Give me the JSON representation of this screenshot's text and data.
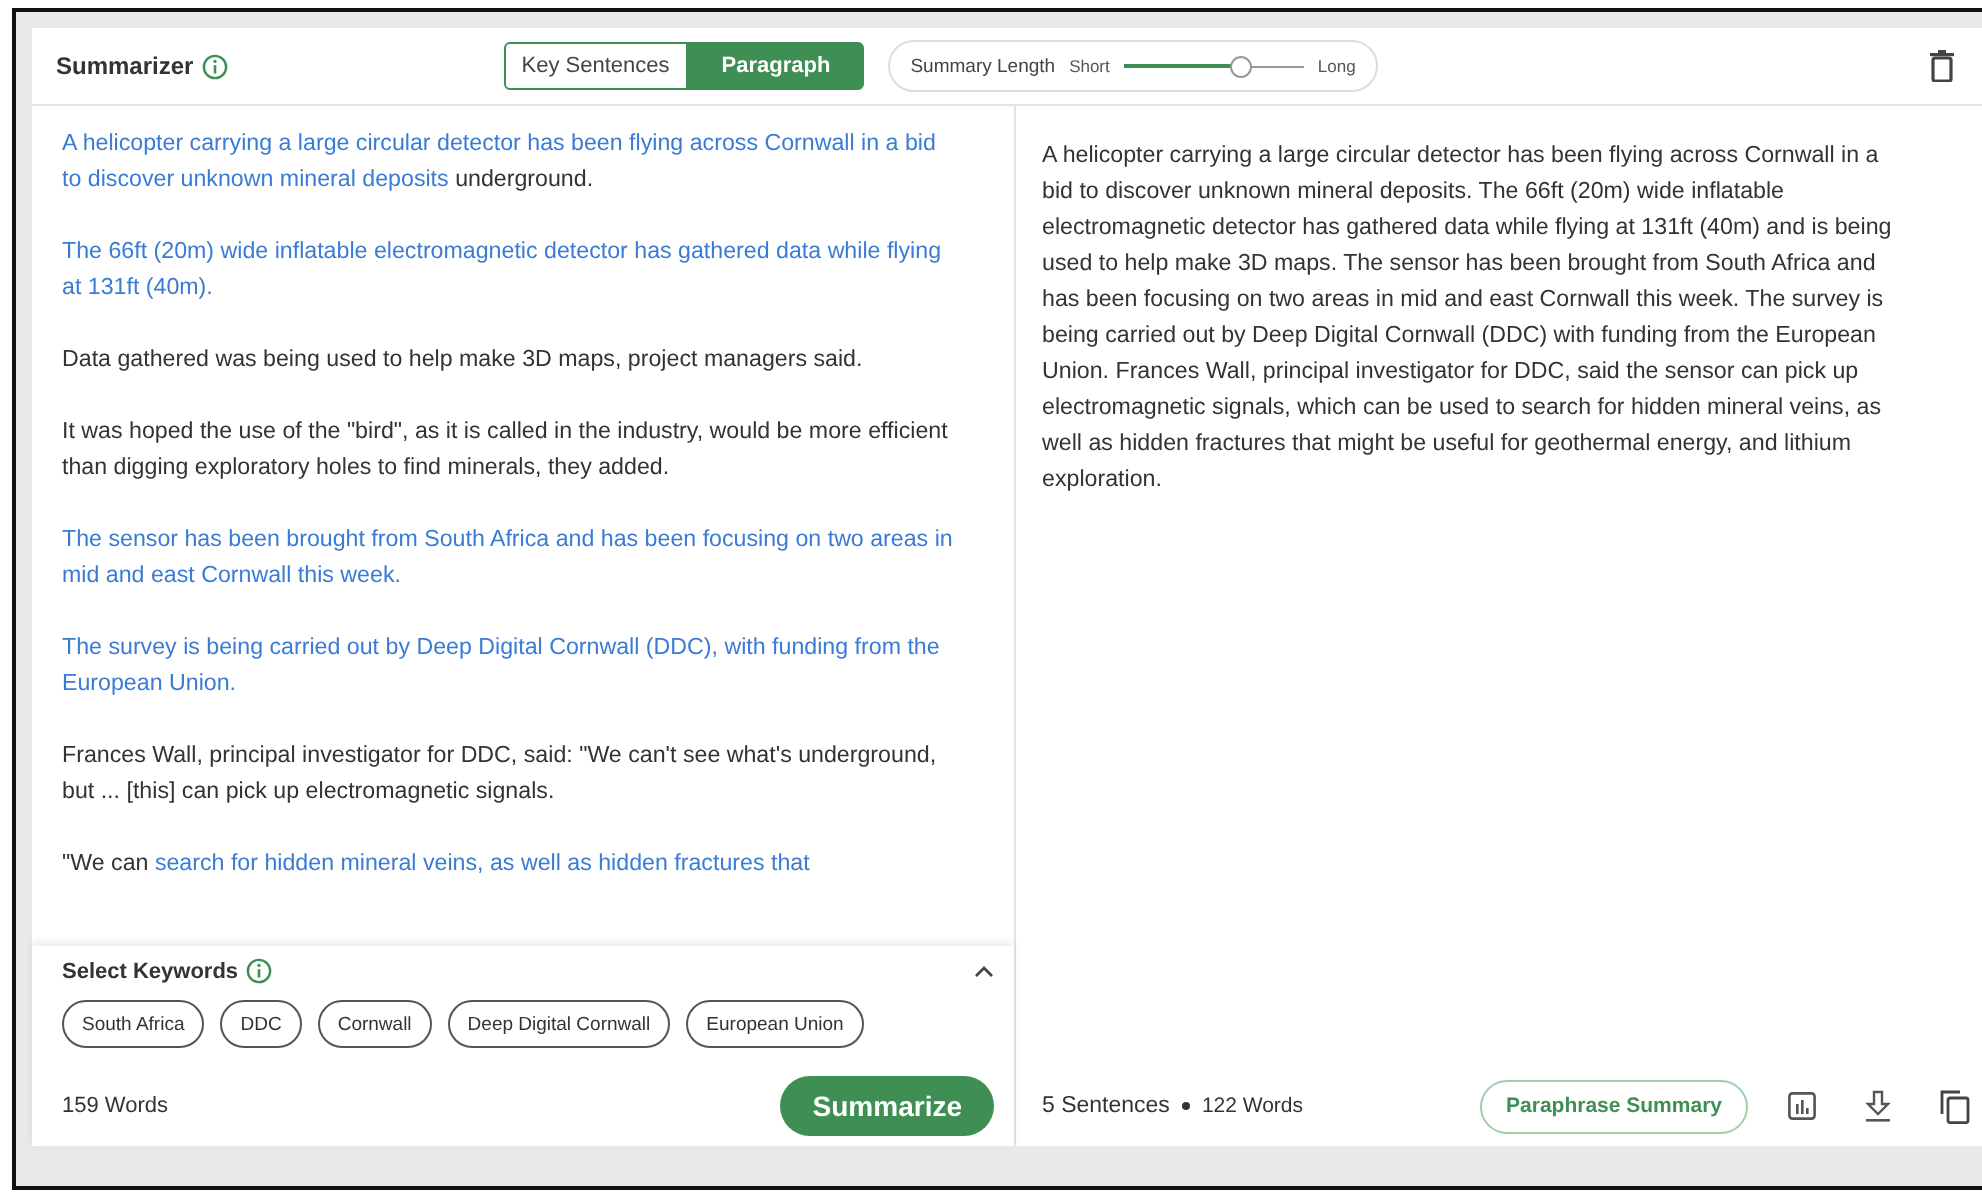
{
  "header": {
    "title": "Summarizer",
    "tabs": [
      {
        "label": "Key Sentences",
        "selected": false
      },
      {
        "label": "Paragraph",
        "selected": true
      }
    ],
    "length": {
      "label": "Summary Length",
      "min_label": "Short",
      "max_label": "Long",
      "level": 0.66
    }
  },
  "source": {
    "paragraphs": [
      [
        {
          "text": "A helicopter carrying a large circular detector has been flying across Cornwall in a bid to discover unknown mineral deposits",
          "highlighted": true
        },
        {
          "text": " underground.",
          "highlighted": false
        }
      ],
      [
        {
          "text": "The 66ft (20m) wide inflatable electromagnetic detector has gathered data while flying at 131ft (40m).",
          "highlighted": true
        }
      ],
      [
        {
          "text": "Data gathered was being used to help make 3D maps, project managers said.",
          "highlighted": false
        }
      ],
      [
        {
          "text": "It was hoped the use of the \"bird\", as it is called in the industry, would be more efficient than digging exploratory holes to find minerals, they added.",
          "highlighted": false
        }
      ],
      [
        {
          "text": "The sensor has been brought from South Africa and has been focusing on two areas in mid and east Cornwall this week.",
          "highlighted": true
        }
      ],
      [
        {
          "text": "The survey is being carried out by Deep Digital Cornwall (DDC), with funding from the European Union.",
          "highlighted": true
        }
      ],
      [
        {
          "text": "Frances Wall, principal investigator for DDC, said: \"We can't see what's underground, but ... [this] can pick up electromagnetic signals.",
          "highlighted": false
        }
      ],
      [
        {
          "text": "\"We can ",
          "highlighted": false
        },
        {
          "text": "search for hidden mineral veins, as well as hidden fractures that",
          "highlighted": true
        }
      ]
    ],
    "keywords": {
      "title": "Select Keywords",
      "expanded": true,
      "items": [
        "South Africa",
        "DDC",
        "Cornwall",
        "Deep Digital Cornwall",
        "European Union"
      ]
    },
    "word_count": "159 Words",
    "action": "Summarize"
  },
  "summary": {
    "text": "A helicopter carrying a large circular detector has been flying across Cornwall in a bid to discover unknown mineral deposits. The 66ft (20m) wide inflatable electromagnetic detector has gathered data while flying at 131ft (40m) and is being used to help make 3D maps. The sensor has been brought from South Africa and has been focusing on two areas in mid and east Cornwall this week. The survey is being carried out by Deep Digital Cornwall (DDC) with funding from the European Union. Frances Wall, principal investigator for DDC, said the sensor can pick up electromagnetic signals, which can be used to search for hidden mineral veins, as well as hidden fractures that might be useful for geothermal energy, and lithium exploration.",
    "sentence_count": "5 Sentences",
    "word_count": "122 Words",
    "action": "Paraphrase Summary"
  }
}
